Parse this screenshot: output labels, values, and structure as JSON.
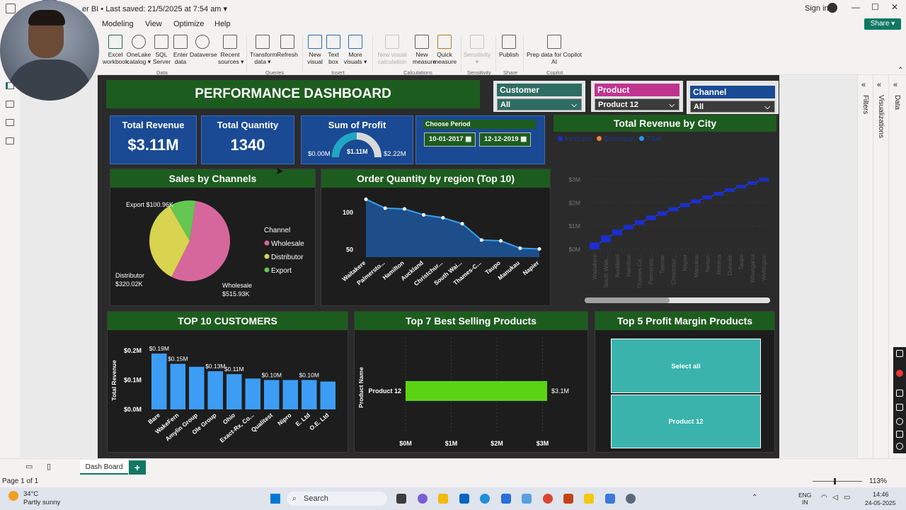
{
  "titlebar": {
    "save_info": "er BI • Last saved: 21/5/2025 at 7:54 am ▾",
    "signin": "Sign in"
  },
  "menu": [
    "Modeling",
    "View",
    "Optimize",
    "Help"
  ],
  "share": "Share",
  "ribbon": {
    "buttons": [
      {
        "label": "Excel\nworkbook"
      },
      {
        "label": "OneLake\ncatalog ▾"
      },
      {
        "label": "SQL\nServer"
      },
      {
        "label": "Enter\ndata"
      },
      {
        "label": "Dataverse"
      },
      {
        "label": "Recent\nsources ▾"
      },
      {
        "label": "Transform\ndata ▾"
      },
      {
        "label": "Refresh"
      },
      {
        "label": "New\nvisual"
      },
      {
        "label": "Text\nbox"
      },
      {
        "label": "More\nvisuals ▾"
      },
      {
        "label": "New visual\ncalculation"
      },
      {
        "label": "New\nmeasure"
      },
      {
        "label": "Quick\nmeasure"
      },
      {
        "label": "Sensitivity\n▾"
      },
      {
        "label": "Publish"
      },
      {
        "label": "Prep data for Copilot\nAI"
      }
    ],
    "groups": [
      "Data",
      "Queries",
      "Insert",
      "Calculations",
      "Sensitivity",
      "Share",
      "Copilot"
    ]
  },
  "dashboard": {
    "title": "PERFORMANCE DASHBOARD",
    "slicers": {
      "customer": {
        "label": "Customer",
        "value": "All",
        "color": "#2f6c63"
      },
      "product": {
        "label": "Product",
        "value": "Product 12",
        "color": "#c0348f"
      },
      "channel": {
        "label": "Channel",
        "value": "All",
        "color": "#1a4a93"
      }
    },
    "kpis": {
      "revenue": {
        "label": "Total Revenue",
        "value": "$3.11M"
      },
      "quantity": {
        "label": "Total Quantity",
        "value": "1340"
      },
      "profit": {
        "label": "Sum of Profit",
        "min": "$0.00M",
        "value": "$1.11M",
        "max": "$2.22M"
      }
    },
    "period": {
      "label": "Choose Period",
      "start": "10-01-2017",
      "end": "12-12-2019"
    },
    "city_chart": {
      "title": "Total Revenue by City",
      "legend": [
        "Increase",
        "Decrease",
        "Total"
      ]
    },
    "channels": {
      "title": "Sales by Channels",
      "legend_title": "Channel"
    },
    "region": {
      "title": "Order Quantity by region (Top 10)"
    },
    "customers": {
      "title": "TOP 10 CUSTOMERS"
    },
    "products": {
      "title": "Top 7 Best Selling Products"
    },
    "profit_margin": {
      "title": "Top 5 Profit Margin Products",
      "items": [
        "Select all",
        "Product 12"
      ],
      "color": "#3ab3ad"
    }
  },
  "chart_data": [
    {
      "type": "pie",
      "title": "Sales by Channels",
      "categories": [
        "Wholesale",
        "Distributor",
        "Export"
      ],
      "values": [
        515.93,
        320.02,
        100.96
      ],
      "data_labels": [
        "Wholesale\n$515.93K",
        "Distributor\n$320.02K",
        "Export $100.96K"
      ],
      "colors": [
        "#d6679c",
        "#d8d44f",
        "#63c752"
      ],
      "legend_title": "Channel",
      "legend": "right"
    },
    {
      "type": "area",
      "title": "Order Quantity by region (Top 10)",
      "categories": [
        "Waitakere",
        "Palmersto...",
        "Hamilton",
        "Auckland",
        "Christchur...",
        "South Wai...",
        "Thames-C...",
        "Taupo",
        "Manukau",
        "Napier"
      ],
      "values": [
        118,
        106,
        105,
        97,
        93,
        85,
        63,
        62,
        52,
        51
      ],
      "ytick_labels": [
        "100",
        "50"
      ],
      "ylim": [
        40,
        125
      ]
    },
    {
      "type": "bar",
      "title": "Total Revenue by City",
      "subtype": "waterfall",
      "categories": [
        "Waitakere",
        "South Waik...",
        "Auckland",
        "Hamilton",
        "Thames-Co...",
        "Palmersto...",
        "Tasman",
        "Christchur...",
        "Napier",
        "Manukau",
        "Nelson",
        "Rotorua",
        "Dunedin",
        "Taupo",
        "Whanganui",
        "Wellington"
      ],
      "ytick_labels": [
        "$0M",
        "$1M",
        "$2M",
        "$3M"
      ],
      "ylim": [
        0,
        3.5
      ],
      "values": [
        0.3,
        0.3,
        0.25,
        0.2,
        0.2,
        0.2,
        0.18,
        0.18,
        0.17,
        0.17,
        0.16,
        0.16,
        0.15,
        0.15,
        0.15,
        0.15
      ],
      "color": "#1a2fd0"
    },
    {
      "type": "bar",
      "title": "TOP 10 CUSTOMERS",
      "categories": [
        "Bare",
        "WakeFern",
        "Amylin Group",
        "Ole Group",
        "Ohio",
        "Exact-Rx, Co...",
        "Qualitest",
        "Nipro",
        "E. Ltd",
        "O.E. Ltd"
      ],
      "values": [
        0.19,
        0.155,
        0.145,
        0.13,
        0.12,
        0.105,
        0.1,
        0.1,
        0.1,
        0.095
      ],
      "data_labels": [
        "$0.19M",
        "$0.15M",
        "",
        "$0.13M",
        "$0.11M",
        "",
        "$0.10M",
        "",
        "$0.10M",
        ""
      ],
      "ylabel": "Total Revenue",
      "ytick_labels": [
        "$0.2M",
        "$0.1M",
        "$0.0M"
      ],
      "ylim": [
        0,
        0.2
      ],
      "color": "#3d9df5"
    },
    {
      "type": "bar",
      "title": "Top 7 Best Selling Products",
      "orientation": "horizontal",
      "categories": [
        "Product 12"
      ],
      "values": [
        3.1
      ],
      "data_labels": [
        "$3.1M"
      ],
      "ylabel": "Product Name",
      "xtick_labels": [
        "$0M",
        "$1M",
        "$2M",
        "$3M"
      ],
      "xlim": [
        0,
        3.1
      ],
      "color": "#5ad314"
    }
  ],
  "right_panes": [
    "Filters",
    "Visualizations",
    "Data"
  ],
  "tabs": {
    "active": "Dash Board"
  },
  "status": {
    "page": "Page 1 of 1",
    "zoom": "113%"
  },
  "taskbar": {
    "weather_temp": "34°C",
    "weather_desc": "Partly sunny",
    "search": "Search",
    "lang": "ENG\nIN",
    "time": "14:46",
    "date": "24-05-2025"
  }
}
